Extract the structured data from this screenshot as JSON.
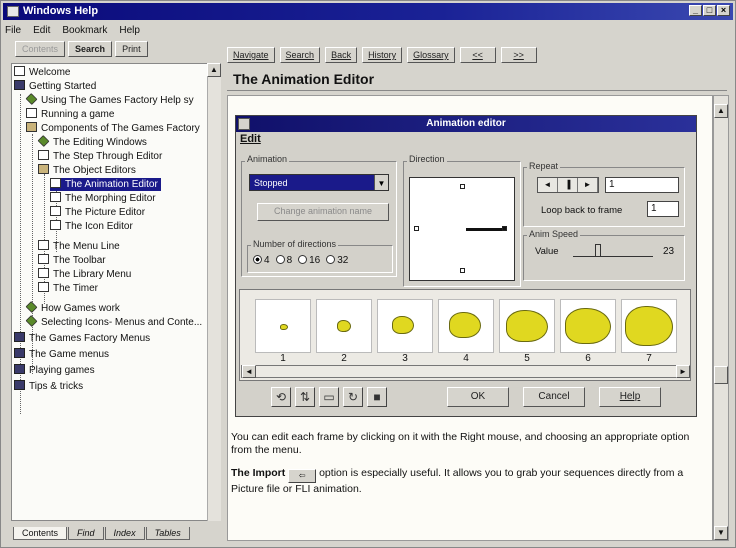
{
  "window": {
    "title": "Windows Help",
    "controls": [
      "_",
      "□",
      "×"
    ]
  },
  "menubar": [
    "File",
    "Edit",
    "Bookmark",
    "Help"
  ],
  "left_toolbar": [
    "Contents",
    "Search",
    "Print"
  ],
  "toc": [
    {
      "label": "Welcome",
      "icon": "page"
    },
    {
      "label": "Getting Started",
      "icon": "book"
    },
    {
      "label": "Using The Games Factory Help sy",
      "icon": "diamond"
    },
    {
      "label": "Running a game",
      "icon": "page"
    },
    {
      "label": "Components of The Games Factory",
      "icon": "open-book"
    },
    {
      "label": "The Editing Windows",
      "icon": "diamond"
    },
    {
      "label": "The Step Through Editor",
      "icon": "page"
    },
    {
      "label": "The Object Editors",
      "icon": "open-book"
    },
    {
      "label": "The Animation Editor",
      "icon": "page",
      "selected": true
    },
    {
      "label": "The Morphing Editor",
      "icon": "page"
    },
    {
      "label": "The Picture Editor",
      "icon": "page"
    },
    {
      "label": "The Icon Editor",
      "icon": "page"
    },
    {
      "label": "The Menu Line",
      "icon": "page"
    },
    {
      "label": "The Toolbar",
      "icon": "page"
    },
    {
      "label": "The Library Menu",
      "icon": "page"
    },
    {
      "label": "The Timer",
      "icon": "page"
    },
    {
      "label": "How Games work",
      "icon": "diamond"
    },
    {
      "label": "Selecting Icons- Menus and Conte...",
      "icon": "diamond"
    },
    {
      "label": "The Games Factory Menus",
      "icon": "book"
    },
    {
      "label": "The Game menus",
      "icon": "book"
    },
    {
      "label": "Playing games",
      "icon": "book"
    },
    {
      "label": "Tips & tricks",
      "icon": "book"
    }
  ],
  "tabs": [
    "Contents",
    "Find",
    "Index",
    "Tables"
  ],
  "right_toolbar": [
    "Navigate",
    "Search",
    "Back",
    "History",
    "Glossary",
    "<<",
    ">>"
  ],
  "topic_title": "The Animation Editor",
  "editor": {
    "title": "Animation editor",
    "menu": "Edit",
    "animation_label": "Animation",
    "animation_value": "Stopped",
    "change_button": "Change animation name",
    "num_dirs_label": "Number of directions",
    "dir_options": [
      "4",
      "8",
      "16",
      "32"
    ],
    "direction_label": "Direction",
    "repeat_label": "Repeat",
    "repeat_value": "1",
    "loop_label": "Loop back to frame",
    "loop_value": "1",
    "speed_label": "Anim Speed",
    "speed_value_label": "Value",
    "speed_value": "23",
    "frames": [
      "1",
      "2",
      "3",
      "4",
      "5",
      "6",
      "7"
    ],
    "ok": "OK",
    "cancel": "Cancel",
    "help": "Help"
  },
  "paragraph1": "You can edit each frame by clicking on it with the Right mouse, and choosing an appropriate option from the menu.",
  "paragraph2_pre": "The Import",
  "paragraph2_post": "option is especially useful. It allows you to grab your sequences directly from a Picture file or FLI animation."
}
